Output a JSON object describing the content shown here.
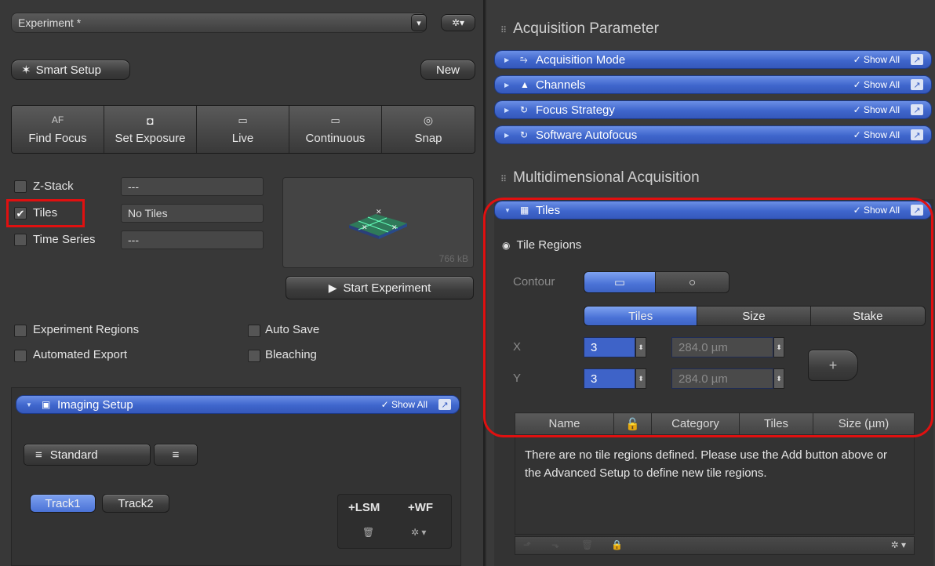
{
  "left": {
    "experiment": {
      "value": "Experiment *",
      "dropdown": "▾",
      "gear": "✲▾"
    },
    "smart_setup": "Smart Setup",
    "new_btn": "New",
    "toolbar": [
      {
        "icon": "AF",
        "label": "Find Focus",
        "name": "find-focus"
      },
      {
        "icon": "◘",
        "label": "Set Exposure",
        "name": "set-exposure"
      },
      {
        "icon": "▭",
        "label": "Live",
        "name": "live"
      },
      {
        "icon": "▭",
        "label": "Continuous",
        "name": "continuous"
      },
      {
        "icon": "◎",
        "label": "Snap",
        "name": "snap"
      }
    ],
    "options": [
      {
        "label": "Z-Stack",
        "checked": false,
        "value": "---"
      },
      {
        "label": "Tiles",
        "checked": true,
        "value": "No Tiles"
      },
      {
        "label": "Time Series",
        "checked": false,
        "value": "---"
      }
    ],
    "preview_size": "766 kB",
    "start_experiment": "Start Experiment",
    "checks": {
      "experiment_regions": "Experiment Regions",
      "auto_save": "Auto Save",
      "automated_export": "Automated Export",
      "bleaching": "Bleaching"
    },
    "imaging_setup": {
      "title": "Imaging Setup",
      "show_all": "✓ Show All"
    },
    "standard": "Standard",
    "tracks": [
      "Track1",
      "Track2"
    ],
    "lsm": "+LSM",
    "wf": "+WF"
  },
  "right": {
    "acq_param_title": "Acquisition Parameter",
    "acq_bars": [
      {
        "title": "Acquisition Mode",
        "icon": "⥲",
        "name": "acquisition-mode"
      },
      {
        "title": "Channels",
        "icon": "▲",
        "name": "channels"
      },
      {
        "title": "Focus Strategy",
        "icon": "↻",
        "name": "focus-strategy"
      },
      {
        "title": "Software Autofocus",
        "icon": "↻",
        "name": "software-autofocus"
      }
    ],
    "show_all": "✓ Show All",
    "multi_title": "Multidimensional Acquisition",
    "tiles_bar": "Tiles",
    "tile_regions": "Tile Regions",
    "contour": "Contour",
    "tabs": [
      "Tiles",
      "Size",
      "Stake"
    ],
    "x_label": "X",
    "y_label": "Y",
    "x_value": "3",
    "y_value": "3",
    "x_size": "284.0 µm",
    "y_size": "284.0 µm",
    "add_btn": "+",
    "columns": [
      "Name",
      "",
      "Category",
      "Tiles",
      "Size (µm)"
    ],
    "empty_msg": "There are no tile regions defined. Please use the Add button above or the Advanced Setup to define new tile regions."
  },
  "colors": {
    "accent_blue": "#4a72d6",
    "highlight_red": "#e01010"
  }
}
